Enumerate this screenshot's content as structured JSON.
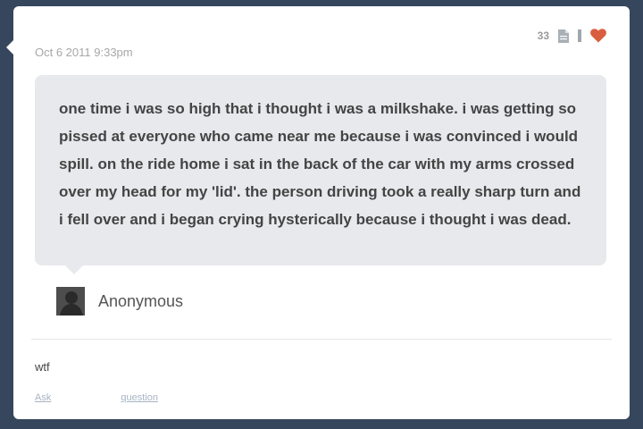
{
  "post": {
    "date": "Oct 6 2011 9:33pm",
    "note_count": "33",
    "question": "one time i was so high that i thought i was a milkshake. i was getting so pissed at everyone who came near me because i was convinced i would spill. on the ride home i sat in the back of the car with my arms crossed over my head for my 'lid'. the person driving took a really sharp turn and i fell over and i began crying hysterically because i thought i was dead.",
    "asker_name": "Anonymous",
    "answer": "wtf",
    "footer": {
      "ask_link": "Ask",
      "question_link": "question"
    }
  },
  "icons": {
    "notes": "notes-icon",
    "reblog": "reblog-icon",
    "like": "heart-icon",
    "avatar": "anonymous-avatar"
  },
  "colors": {
    "background": "#36465d",
    "card": "#ffffff",
    "bubble": "#e7e9ec",
    "heart": "#d95e40",
    "link": "#a7b4c3"
  }
}
